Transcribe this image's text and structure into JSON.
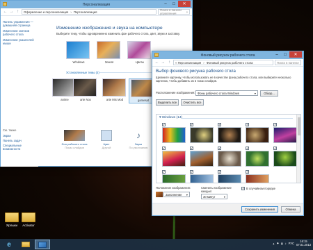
{
  "personalization": {
    "title": "Персонализация",
    "breadcrumb": [
      "Оформление и персонализация",
      "Персонализация"
    ],
    "search_placeholder": "Поиск в панели управления",
    "left_pane": {
      "home": "Панель управления — домашняя страница",
      "change_icons": "Изменение значков рабочего стола",
      "change_pointers": "Изменение указателей мыши",
      "see_also_label": "См. также",
      "see_also": [
        "Экран",
        "Панель задач",
        "Специальные возможности"
      ]
    },
    "heading": "Изменение изображения и звука на компьютере",
    "subtitle": "Выберите тему, чтобы одновременно изменить фон рабочего стола, цвет, звуки и заставку.",
    "themes_top": [
      "Windows",
      "Земля",
      "Цветы"
    ],
    "installed_label": "Установленные темы (4)",
    "themes_installed": [
      "anime",
      "arte Nox",
      "arte Mix Mod",
      "gamesat"
    ],
    "bottom": [
      {
        "label": "Фон рабочего стола",
        "value": "Показ слайдов"
      },
      {
        "label": "Цвет",
        "value": "Другой"
      },
      {
        "label": "Звуки",
        "value": "По умолчанию"
      }
    ]
  },
  "desktop_bg": {
    "title": "Фоновый рисунок рабочего стола",
    "breadcrumb": [
      "« Персонализация",
      "Фоновый рисунок рабочего стола"
    ],
    "search_placeholder": "Поиск в панели управления",
    "heading": "Выбор фонового рисунка рабочего стола",
    "subtitle": "Щелкните картинку, чтобы использовать ее в качестве фона рабочего стола, или выберите несколько картинок, чтобы добавить их в показ слайдов.",
    "location_label": "Расположение изображения:",
    "location_value": "Фоны рабочего стола Windows",
    "browse": "Обзор...",
    "select_all": "Выделить все",
    "clear_all": "Очистить все",
    "group_label": "Windows (14)",
    "position_label": "Положение изображения:",
    "position_value": "Заполнение",
    "interval_label": "Сменить изображение каждые:",
    "interval_value": "30 минут",
    "shuffle_label": "В случайном порядке",
    "save": "Сохранить изменения",
    "cancel": "Отмена"
  },
  "desktop_icons": [
    "Ярлыки",
    "Activator"
  ],
  "tray": {
    "lang": "РУС",
    "time": "16:15",
    "date": "07.01.2013"
  },
  "colors": {
    "accent": "#1a4f8a",
    "titlebar": "#7fb5df",
    "taskbar": "#1e3246"
  }
}
